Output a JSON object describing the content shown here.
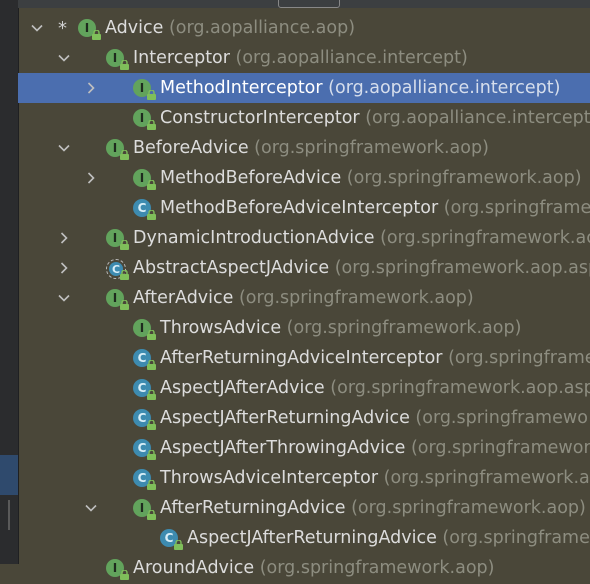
{
  "tree": [
    {
      "name": "Advice",
      "pkg": "(org.aopalliance.aop)",
      "kind": "interface",
      "arrow": "down",
      "star": true
    },
    {
      "name": "Interceptor",
      "pkg": "(org.aopalliance.intercept)",
      "kind": "interface",
      "arrow": "down"
    },
    {
      "name": "MethodInterceptor",
      "pkg": "(org.aopalliance.intercept)",
      "kind": "interface",
      "arrow": "right",
      "selected": true
    },
    {
      "name": "ConstructorInterceptor",
      "pkg": "(org.aopalliance.intercept)",
      "kind": "interface",
      "arrow": "none"
    },
    {
      "name": "BeforeAdvice",
      "pkg": "(org.springframework.aop)",
      "kind": "interface",
      "arrow": "down"
    },
    {
      "name": "MethodBeforeAdvice",
      "pkg": "(org.springframework.aop)",
      "kind": "interface",
      "arrow": "right"
    },
    {
      "name": "MethodBeforeAdviceInterceptor",
      "pkg": "(org.springframe",
      "kind": "class",
      "arrow": "none"
    },
    {
      "name": "DynamicIntroductionAdvice",
      "pkg": "(org.springframework.ac",
      "kind": "interface",
      "arrow": "right"
    },
    {
      "name": "AbstractAspectJAdvice",
      "pkg": "(org.springframework.aop.asp",
      "kind": "abstract",
      "arrow": "right"
    },
    {
      "name": "AfterAdvice",
      "pkg": "(org.springframework.aop)",
      "kind": "interface",
      "arrow": "down"
    },
    {
      "name": "ThrowsAdvice",
      "pkg": "(org.springframework.aop)",
      "kind": "interface",
      "arrow": "none"
    },
    {
      "name": "AfterReturningAdviceInterceptor",
      "pkg": "(org.springframe",
      "kind": "class",
      "arrow": "none"
    },
    {
      "name": "AspectJAfterAdvice",
      "pkg": "(org.springframework.aop.asp",
      "kind": "class",
      "arrow": "none"
    },
    {
      "name": "AspectJAfterReturningAdvice",
      "pkg": "(org.springframewo",
      "kind": "class",
      "arrow": "none"
    },
    {
      "name": "AspectJAfterThrowingAdvice",
      "pkg": "(org.springframewor",
      "kind": "class",
      "arrow": "none"
    },
    {
      "name": "ThrowsAdviceInterceptor",
      "pkg": "(org.springframework.ac",
      "kind": "class",
      "arrow": "none"
    },
    {
      "name": "AfterReturningAdvice",
      "pkg": "(org.springframework.aop)",
      "kind": "interface",
      "arrow": "down"
    },
    {
      "name": "AspectJAfterReturningAdvice",
      "pkg": "(org.springframe",
      "kind": "class",
      "arrow": "none"
    },
    {
      "name": "AroundAdvice",
      "pkg": "(org.springframework.aop)",
      "kind": "interface",
      "arrow": "none"
    }
  ],
  "icons": {
    "interface": "interface-icon",
    "class": "class-icon",
    "abstract": "abstract-class-icon",
    "lock": "lock-icon"
  },
  "colors": {
    "background": "#4a4739",
    "selection": "#4b6eaf",
    "interface": "#62a35c",
    "class": "#3d8bb0"
  }
}
